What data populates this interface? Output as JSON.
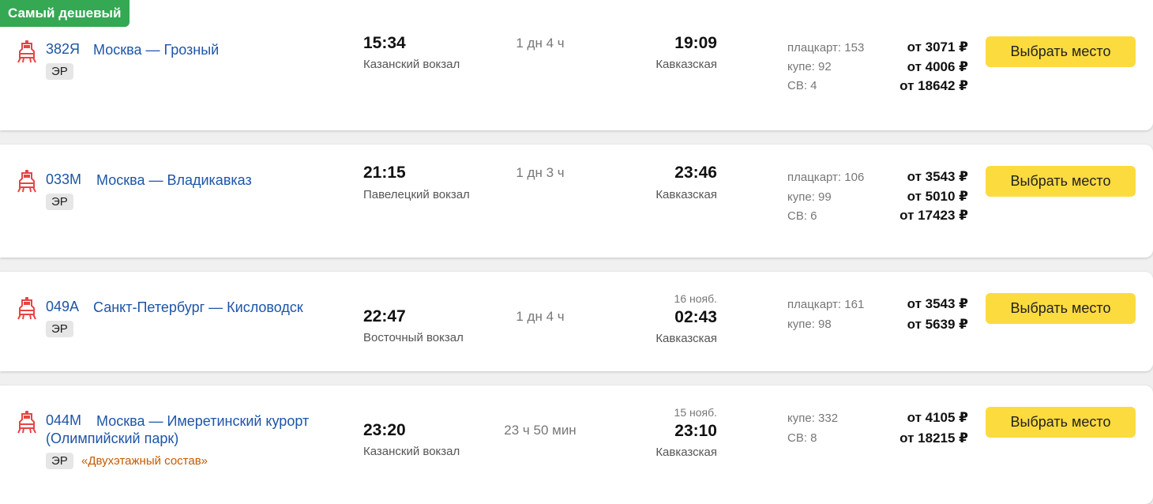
{
  "badge": "Самый дешевый",
  "colors": {
    "link": "#1d55a8",
    "button": "#fcdb3f",
    "badge": "#34a853",
    "icon": "#e64545",
    "note": "#c55a00"
  },
  "icons": {
    "train": "train-icon"
  },
  "trains": [
    {
      "number": "382Я",
      "route": "Москва — Грозный",
      "type": "ЭР",
      "note": "",
      "dep_time": "15:34",
      "dep_station": "Казанский вокзал",
      "duration": "1 дн 4 ч",
      "arr_date": "",
      "arr_time": "19:09",
      "arr_station": "Кавказская",
      "seats": [
        "плацкарт: 153",
        "купе: 92",
        "СВ: 4"
      ],
      "prices": [
        "от 3071 ₽",
        "от 4006 ₽",
        "от 18642 ₽"
      ],
      "button": "Выбрать место"
    },
    {
      "number": "033М",
      "route": "Москва — Владикавказ",
      "type": "ЭР",
      "note": "",
      "dep_time": "21:15",
      "dep_station": "Павелецкий вокзал",
      "duration": "1 дн 3 ч",
      "arr_date": "",
      "arr_time": "23:46",
      "arr_station": "Кавказская",
      "seats": [
        "плацкарт: 106",
        "купе: 99",
        "СВ: 6"
      ],
      "prices": [
        "от 3543 ₽",
        "от 5010 ₽",
        "от 17423 ₽"
      ],
      "button": "Выбрать место"
    },
    {
      "number": "049А",
      "route": "Санкт-Петербург — Кисловодск",
      "type": "ЭР",
      "note": "",
      "dep_time": "22:47",
      "dep_station": "Восточный вокзал",
      "duration": "1 дн 4 ч",
      "arr_date": "16 нояб.",
      "arr_time": "02:43",
      "arr_station": "Кавказская",
      "seats": [
        "плацкарт: 161",
        "купе: 98"
      ],
      "prices": [
        "от 3543 ₽",
        "от 5639 ₽"
      ],
      "button": "Выбрать место"
    },
    {
      "number": "044М",
      "route_line1": "Москва — Имеретинский курорт",
      "route_line2": "(Олимпийский парк)",
      "type": "ЭР",
      "note": "«Двухэтажный состав»",
      "dep_time": "23:20",
      "dep_station": "Казанский вокзал",
      "duration": "23 ч 50 мин",
      "arr_date": "15 нояб.",
      "arr_time": "23:10",
      "arr_station": "Кавказская",
      "seats": [
        "купе: 332",
        "СВ: 8"
      ],
      "prices": [
        "от 4105 ₽",
        "от 18215 ₽"
      ],
      "button": "Выбрать место"
    }
  ]
}
